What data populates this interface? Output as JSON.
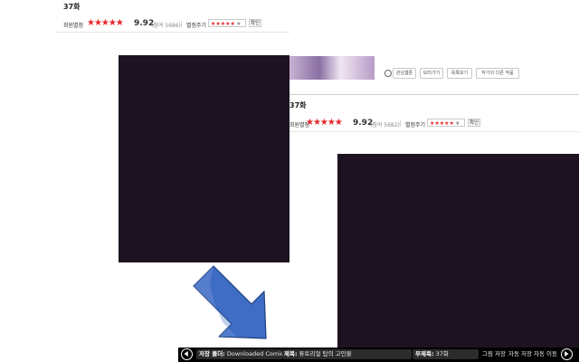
{
  "colors": {
    "star_red": "#e8262b",
    "dark_panel": "#1d1320",
    "arrow_blue": "#3f6cc4",
    "bottom_bar": "#000000"
  },
  "episode_top": {
    "title": "37화",
    "rating_label": "회원별점",
    "stars": "★★★★★",
    "score": "9.92",
    "participants": "(참여 5686)",
    "rate_label": "별점주기",
    "rate_select": "★★★★★",
    "confirm": "확인"
  },
  "episode_bottom": {
    "title": "37화",
    "rating_label": "회원별점",
    "stars": "★★★★★",
    "score": "9.92",
    "participants": "(참여 5682)",
    "rate_label": "별점주기",
    "rate_select": "★★★★★",
    "confirm": "확인"
  },
  "action_buttons": [
    "관심웹툰",
    "보러가기",
    "목록보기",
    "작가의 다른 작품"
  ],
  "bottom_bar": {
    "folder_label": "저장 폴더:",
    "folder_value": "Downloaded Comics",
    "title_label": "제목:",
    "title_value": "튜토리얼 탑의 고인물",
    "subtitle_label": "부제목:",
    "subtitle_value": "37화",
    "save_image": "그림 저장",
    "auto_save": "자동 저장",
    "auto_move": "자동 이동"
  },
  "icons": {
    "prev": "arrow-left-icon",
    "next": "arrow-right-icon",
    "pointer": "blue-arrow-icon"
  }
}
